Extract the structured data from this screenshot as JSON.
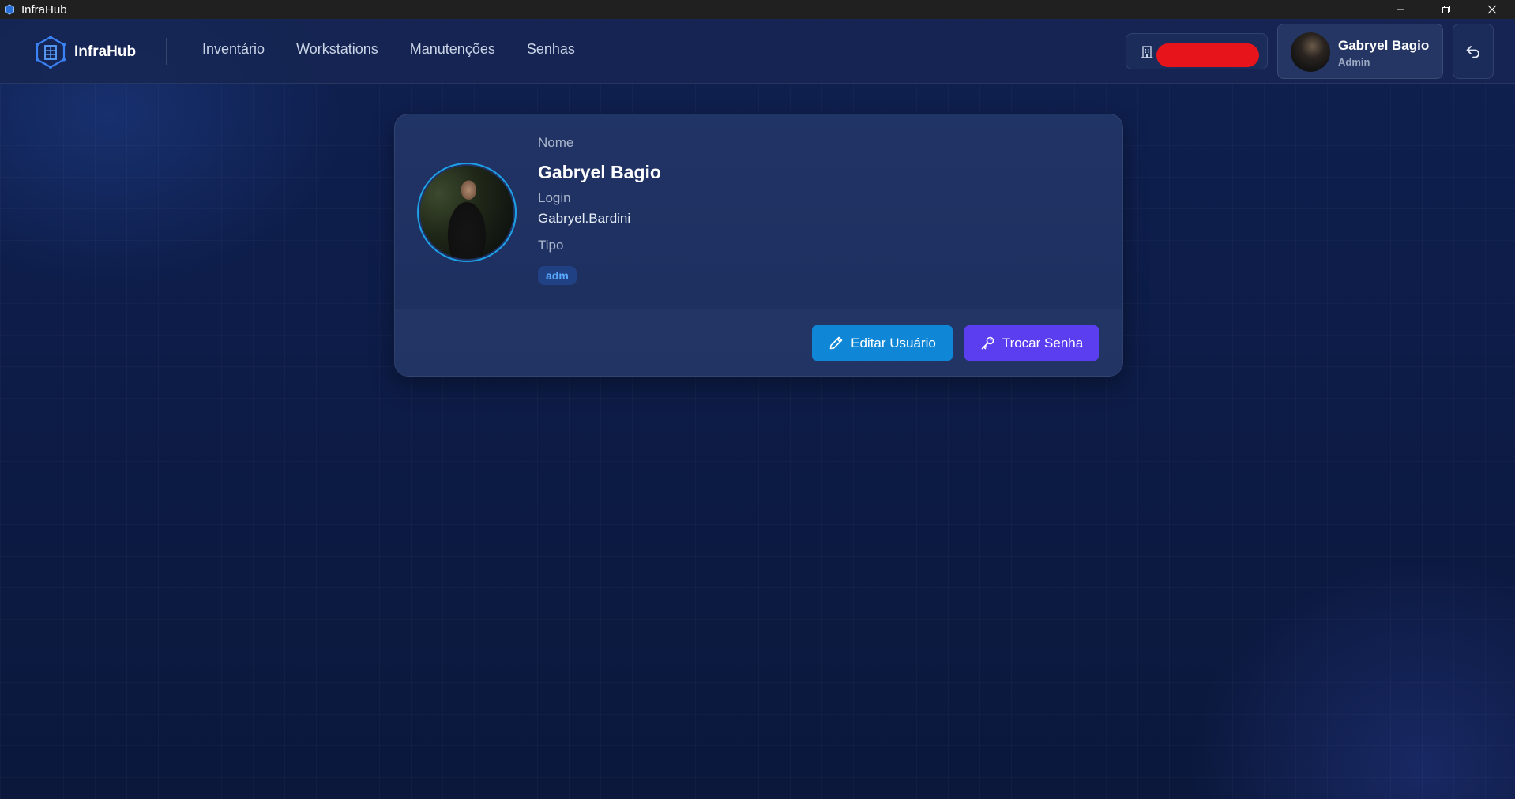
{
  "window": {
    "title": "InfraHub"
  },
  "header": {
    "brand": "InfraHub",
    "nav": [
      "Inventário",
      "Workstations",
      "Manutenções",
      "Senhas"
    ],
    "user": {
      "name": "Gabryel Bagio",
      "role": "Admin"
    }
  },
  "profile": {
    "name_label": "Nome",
    "name_value": "Gabryel Bagio",
    "login_label": "Login",
    "login_value": "Gabryel.Bardini",
    "type_label": "Tipo",
    "type_value": "adm",
    "edit_button": "Editar Usuário",
    "password_button": "Trocar Senha"
  },
  "colors": {
    "accent_blue": "#0f86d6",
    "accent_purple": "#5b3ef0",
    "avatar_ring": "#1ea0e6",
    "redaction": "#e8141b"
  },
  "icons": [
    "infrahub-logo-icon",
    "minimize-icon",
    "restore-icon",
    "close-icon",
    "building-icon",
    "logout-icon",
    "pencil-icon",
    "key-icon"
  ]
}
